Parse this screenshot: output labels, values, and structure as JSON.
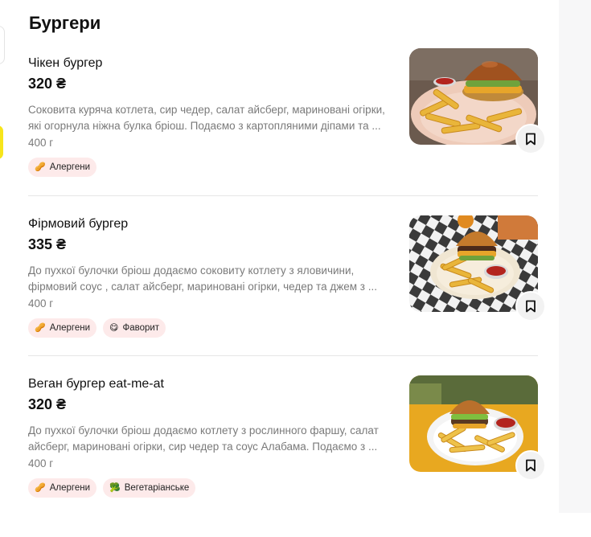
{
  "section": {
    "title": "Бургери"
  },
  "items": [
    {
      "name": "Чікен бургер",
      "price": "320 ₴",
      "description": "Соковита куряча котлета, сир чедер, салат айсберг, мариновані огірки, які огорнула ніжна булка бріош. Подаємо з картопляними діпами та ...",
      "weight": "400 г",
      "tags": [
        {
          "label": "Алергени",
          "icon": "allergen-icon"
        }
      ]
    },
    {
      "name": "Фірмовий бургер",
      "price": "335 ₴",
      "description": "До пухкої булочки бріош додаємо соковиту котлету з яловичини, фірмовий соус , салат айсберг, мариновані огірки, чедер та джем з ...",
      "weight": "400 г",
      "tags": [
        {
          "label": "Алергени",
          "icon": "allergen-icon"
        },
        {
          "label": "Фаворит",
          "icon": "favorite-icon"
        }
      ]
    },
    {
      "name": "Веган бургер eat-me-at",
      "price": "320 ₴",
      "description": "До пухкої булочки бріош додаємо котлету з рослинного фаршу, салат айсберг, мариновані огірки, сир чедер та соус Алабама. Подаємо з ...",
      "weight": "400 г",
      "tags": [
        {
          "label": "Алергени",
          "icon": "allergen-icon"
        },
        {
          "label": "Вегетаріанське",
          "icon": "broccoli-icon"
        }
      ]
    }
  ],
  "icons": {
    "save": "bookmark-icon"
  },
  "colors": {
    "tag_bg": "#fdeaea",
    "muted_text": "#7a7a7a",
    "accent_yellow": "#f7e51b"
  }
}
